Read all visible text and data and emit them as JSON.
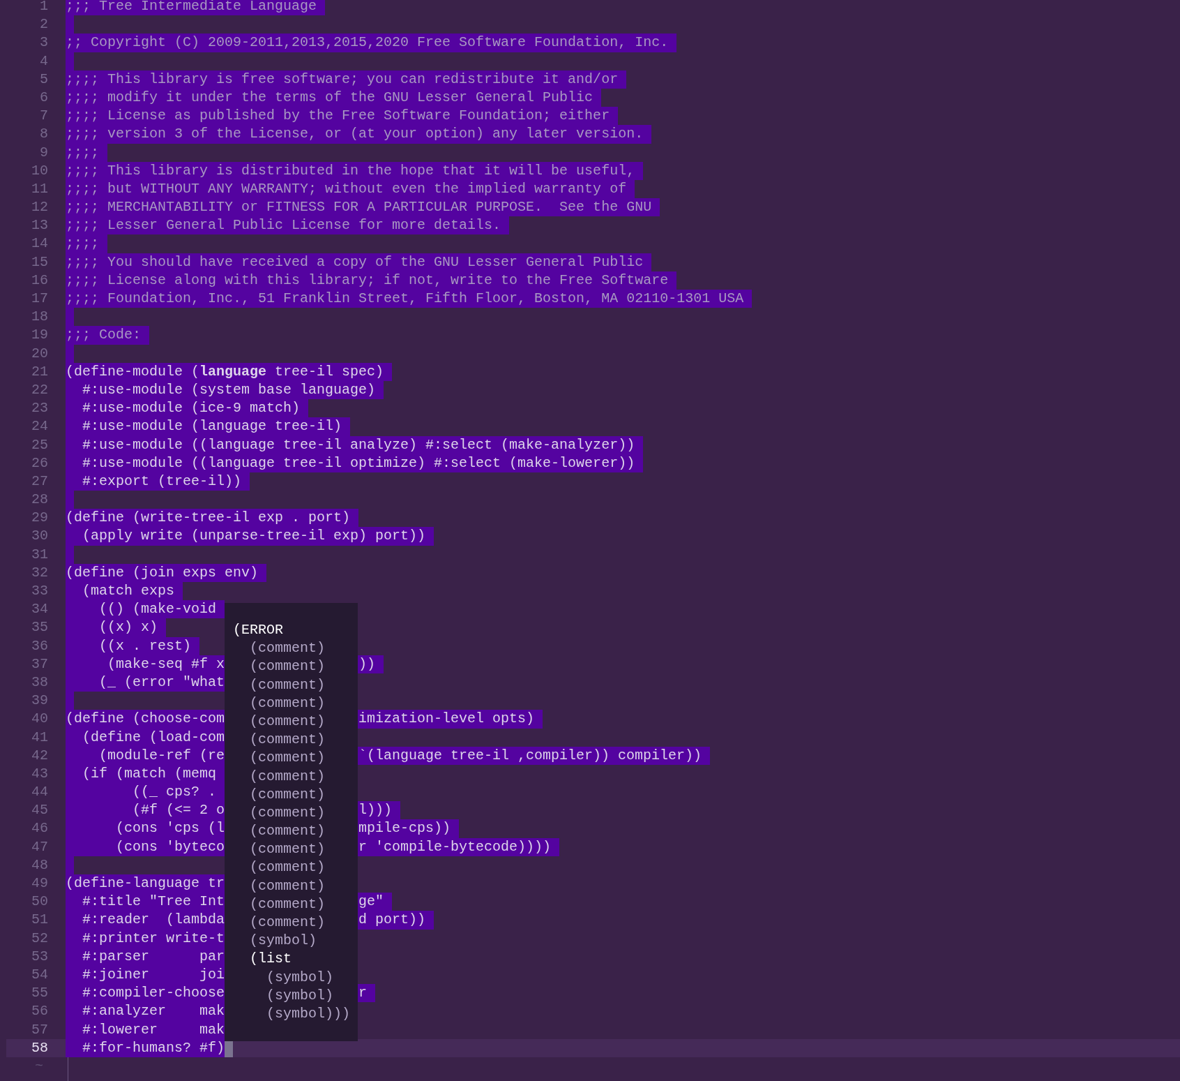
{
  "lines": [
    {
      "number": "1",
      "kind": "comment",
      "text": ";;; Tree Intermediate Language",
      "selected": true,
      "current": false
    },
    {
      "number": "2",
      "kind": "comment",
      "selected": true,
      "current": false
    },
    {
      "number": "3",
      "kind": "comment",
      "text": ";; Copyright (C) 2009-2011,2013,2015,2020 Free Software Foundation, Inc.",
      "selected": true,
      "current": false
    },
    {
      "number": "4",
      "kind": "comment",
      "selected": true,
      "current": false
    },
    {
      "number": "5",
      "kind": "comment",
      "text": ";;;; This library is free software; you can redistribute it and/or",
      "selected": true,
      "current": false
    },
    {
      "number": "6",
      "kind": "comment",
      "text": ";;;; modify it under the terms of the GNU Lesser General Public",
      "selected": true,
      "current": false
    },
    {
      "number": "7",
      "kind": "comment",
      "text": ";;;; License as published by the Free Software Foundation; either",
      "selected": true,
      "current": false
    },
    {
      "number": "8",
      "kind": "comment",
      "text": ";;;; version 3 of the License, or (at your option) any later version.",
      "selected": true,
      "current": false
    },
    {
      "number": "9",
      "kind": "comment",
      "text": ";;;;",
      "selected": true,
      "current": false
    },
    {
      "number": "10",
      "kind": "comment",
      "text": ";;;; This library is distributed in the hope that it will be useful,",
      "selected": true,
      "current": false
    },
    {
      "number": "11",
      "kind": "comment",
      "text": ";;;; but WITHOUT ANY WARRANTY; without even the implied warranty of",
      "selected": true,
      "current": false
    },
    {
      "number": "12",
      "kind": "comment",
      "text": ";;;; MERCHANTABILITY or FITNESS FOR A PARTICULAR PURPOSE.  See the GNU",
      "selected": true,
      "current": false
    },
    {
      "number": "13",
      "kind": "comment",
      "text": ";;;; Lesser General Public License for more details.",
      "selected": true,
      "current": false
    },
    {
      "number": "14",
      "kind": "comment",
      "text": ";;;;",
      "selected": true,
      "current": false
    },
    {
      "number": "15",
      "kind": "comment",
      "text": ";;;; You should have received a copy of the GNU Lesser General Public",
      "selected": true,
      "current": false
    },
    {
      "number": "16",
      "kind": "comment",
      "text": ";;;; License along with this library; if not, write to the Free Software",
      "selected": true,
      "current": false
    },
    {
      "number": "17",
      "kind": "comment",
      "text": ";;;; Foundation, Inc., 51 Franklin Street, Fifth Floor, Boston, MA 02110-1301 USA",
      "selected": true,
      "current": false
    },
    {
      "number": "18",
      "kind": "comment",
      "selected": true,
      "current": false
    },
    {
      "number": "19",
      "kind": "comment",
      "text": ";;; Code:",
      "selected": true,
      "current": false
    },
    {
      "number": "20",
      "kind": "code",
      "selected": true,
      "current": false
    },
    {
      "number": "21",
      "kind": "code",
      "text": "(define-module (**language** tree-il spec)",
      "selected": true,
      "current": false
    },
    {
      "number": "22",
      "kind": "code",
      "text": "  #:use-module (system base language)",
      "selected": true,
      "current": false
    },
    {
      "number": "23",
      "kind": "code",
      "text": "  #:use-module (ice-9 match)",
      "selected": true,
      "current": false
    },
    {
      "number": "24",
      "kind": "code",
      "text": "  #:use-module (language tree-il)",
      "selected": true,
      "current": false
    },
    {
      "number": "25",
      "kind": "code",
      "text": "  #:use-module ((language tree-il analyze) #:select (make-analyzer))",
      "selected": true,
      "current": false
    },
    {
      "number": "26",
      "kind": "code",
      "text": "  #:use-module ((language tree-il optimize) #:select (make-lowerer))",
      "selected": true,
      "current": false
    },
    {
      "number": "27",
      "kind": "code",
      "text": "  #:export (tree-il))",
      "selected": true,
      "current": false
    },
    {
      "number": "28",
      "kind": "code",
      "selected": true,
      "current": false
    },
    {
      "number": "29",
      "kind": "code",
      "text": "(define (write-tree-il exp . port)",
      "selected": true,
      "current": false
    },
    {
      "number": "30",
      "kind": "code",
      "text": "  (apply write (unparse-tree-il exp) port))",
      "selected": true,
      "current": false
    },
    {
      "number": "31",
      "kind": "code",
      "selected": true,
      "current": false
    },
    {
      "number": "32",
      "kind": "code",
      "text": "(define (join exps env)",
      "selected": true,
      "current": false
    },
    {
      "number": "33",
      "kind": "code",
      "text": "  (match exps",
      "selected": true,
      "current": false
    },
    {
      "number": "34",
      "kind": "code",
      "text": "    (() (make-void",
      "selected": true,
      "current": false
    },
    {
      "number": "35",
      "kind": "code",
      "text": "    ((x) x)",
      "selected": true,
      "current": false
    },
    {
      "number": "36",
      "kind": "code",
      "text": "    ((x . rest)",
      "selected": true,
      "current": false
    },
    {
      "number": "37",
      "kind": "code",
      "text": "     (make-seq #f x",
      "after": "))",
      "selected": true,
      "current": false
    },
    {
      "number": "38",
      "kind": "code",
      "text": "    (_ (error \"what",
      "selected": true,
      "current": false
    },
    {
      "number": "39",
      "kind": "code",
      "selected": true,
      "current": false
    },
    {
      "number": "40",
      "kind": "code",
      "text": "(define (choose-com",
      "after": "imization-level opts)",
      "selected": true,
      "current": false
    },
    {
      "number": "41",
      "kind": "code",
      "text": "  (define (load-com",
      "selected": true,
      "current": false
    },
    {
      "number": "42",
      "kind": "code",
      "text": "    (module-ref (re",
      "after": "`(language tree-il ,compiler)) compiler))",
      "selected": true,
      "current": false
    },
    {
      "number": "43",
      "kind": "code",
      "text": "  (if (match (memq",
      "selected": true,
      "current": false
    },
    {
      "number": "44",
      "kind": "code",
      "text": "        ((_ cps? .",
      "selected": true,
      "current": false
    },
    {
      "number": "45",
      "kind": "code",
      "text": "        (#f (<= 2 o",
      "after": "l)))",
      "selected": true,
      "current": false
    },
    {
      "number": "46",
      "kind": "code",
      "text": "      (cons 'cps (l",
      "after": "mpile-cps))",
      "selected": true,
      "current": false
    },
    {
      "number": "47",
      "kind": "code",
      "text": "      (cons 'byteco",
      "after": "r 'compile-bytecode))))",
      "selected": true,
      "current": false
    },
    {
      "number": "48",
      "kind": "code",
      "selected": true,
      "current": false
    },
    {
      "number": "49",
      "kind": "code",
      "text": "(define-language tr",
      "selected": true,
      "current": false
    },
    {
      "number": "50",
      "kind": "code",
      "text": "  #:title \"Tree Int",
      "after": "ge\"",
      "selected": true,
      "current": false
    },
    {
      "number": "51",
      "kind": "code",
      "text": "  #:reader  (lambda",
      "after": "d port))",
      "selected": true,
      "current": false
    },
    {
      "number": "52",
      "kind": "code",
      "text": "  #:printer write-t",
      "selected": true,
      "current": false
    },
    {
      "number": "53",
      "kind": "code",
      "text": "  #:parser      par",
      "selected": true,
      "current": false
    },
    {
      "number": "54",
      "kind": "code",
      "text": "  #:joiner      joi",
      "selected": true,
      "current": false
    },
    {
      "number": "55",
      "kind": "code",
      "text": "  #:compiler-choose",
      "after": "r",
      "selected": true,
      "current": false
    },
    {
      "number": "56",
      "kind": "code",
      "text": "  #:analyzer    mak",
      "selected": true,
      "current": false
    },
    {
      "number": "57",
      "kind": "code",
      "text": "  #:lowerer     mak",
      "selected": true,
      "current": false
    },
    {
      "number": "58",
      "kind": "code",
      "text": "  #:for-humans? #f)",
      "selected": true,
      "current": true
    }
  ],
  "end_marker": "~",
  "popup": {
    "rows": [
      {
        "text": "(ERROR",
        "kind": "node"
      },
      {
        "text": "  (comment)",
        "kind": "leaf"
      },
      {
        "text": "  (comment)",
        "kind": "leaf"
      },
      {
        "text": "  (comment)",
        "kind": "leaf"
      },
      {
        "text": "  (comment)",
        "kind": "leaf"
      },
      {
        "text": "  (comment)",
        "kind": "leaf"
      },
      {
        "text": "  (comment)",
        "kind": "leaf"
      },
      {
        "text": "  (comment)",
        "kind": "leaf"
      },
      {
        "text": "  (comment)",
        "kind": "leaf"
      },
      {
        "text": "  (comment)",
        "kind": "leaf"
      },
      {
        "text": "  (comment)",
        "kind": "leaf"
      },
      {
        "text": "  (comment)",
        "kind": "leaf"
      },
      {
        "text": "  (comment)",
        "kind": "leaf"
      },
      {
        "text": "  (comment)",
        "kind": "leaf"
      },
      {
        "text": "  (comment)",
        "kind": "leaf"
      },
      {
        "text": "  (comment)",
        "kind": "leaf"
      },
      {
        "text": "  (comment)",
        "kind": "leaf"
      },
      {
        "text": "  (symbol)",
        "kind": "leaf"
      },
      {
        "text": "  (list",
        "kind": "node"
      },
      {
        "text": "    (symbol)",
        "kind": "leaf"
      },
      {
        "text": "    (symbol)",
        "kind": "leaf"
      },
      {
        "text": "    (symbol)))",
        "kind": "leaf"
      }
    ]
  }
}
